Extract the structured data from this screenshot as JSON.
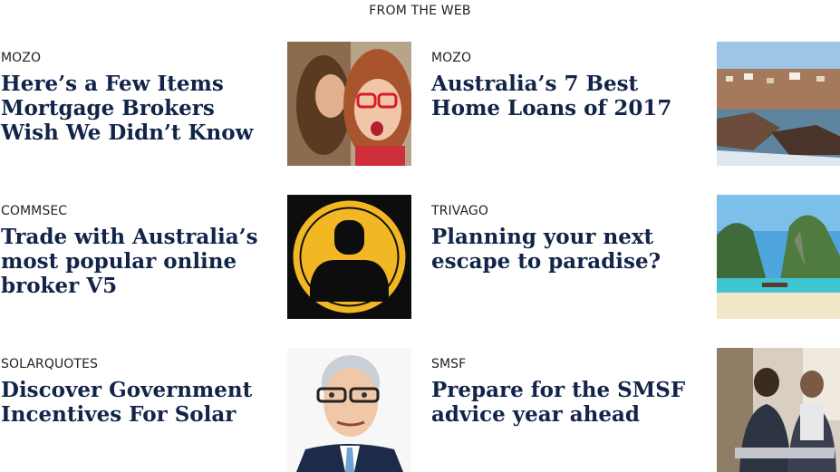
{
  "header": {
    "title": "FROM THE WEB"
  },
  "cards": [
    {
      "source": "MOZO",
      "title": "Here’s a Few Items Mortgage Brokers Wish We Didn’t Know",
      "image_icon": "whispering-women-photo"
    },
    {
      "source": "MOZO",
      "title": "Australia’s 7 Best Home Loans of 2017",
      "image_icon": "coastal-town-photo"
    },
    {
      "source": "COMMSEC",
      "title": "Trade with Australia’s most popular online broker V5",
      "image_icon": "user-avatar-logo"
    },
    {
      "source": "TRIVAGO",
      "title": "Planning your next escape to paradise?",
      "image_icon": "tropical-beach-photo"
    },
    {
      "source": "SOLARQUOTES",
      "title": "Discover Government Incentives For Solar",
      "image_icon": "politician-caricature"
    },
    {
      "source": "SMSF",
      "title": "Prepare for the SMSF advice year ahead",
      "image_icon": "couple-meeting-photo"
    }
  ],
  "colors": {
    "title": "#122448",
    "avatar_yellow": "#f2b824",
    "avatar_black": "#0d0d0d"
  }
}
